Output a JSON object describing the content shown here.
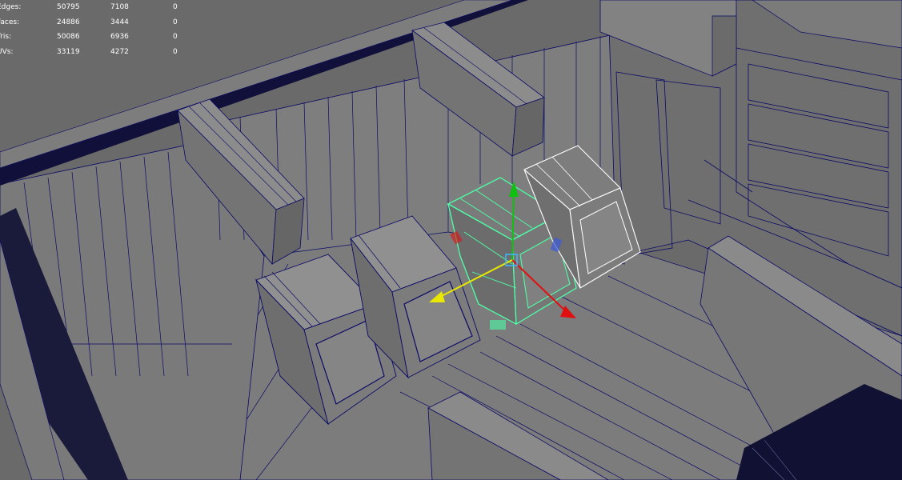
{
  "poly_count_hud": {
    "rows": [
      {
        "label": "Edges:",
        "values": [
          "50795",
          "7108",
          "0"
        ]
      },
      {
        "label": "Faces:",
        "values": [
          "24886",
          "3444",
          "0"
        ]
      },
      {
        "label": "Tris:",
        "values": [
          "50086",
          "6936",
          "0"
        ]
      },
      {
        "label": "UVs:",
        "values": [
          "33119",
          "4272",
          "0"
        ]
      }
    ]
  },
  "viewport": {
    "display_mode": "wireframe-on-shaded",
    "selected_object_color": "#4dffa6",
    "highlighted_object_color": "#ffffff",
    "wire_color": "#0a0a66",
    "surface_color": "#7a7a7a",
    "manipulator": {
      "type": "move",
      "x_axis_color": "#e01010",
      "y_axis_color": "#10c010",
      "z_axis_color": "#e8e800",
      "plane_handle_color": "#3a5ad8"
    }
  }
}
